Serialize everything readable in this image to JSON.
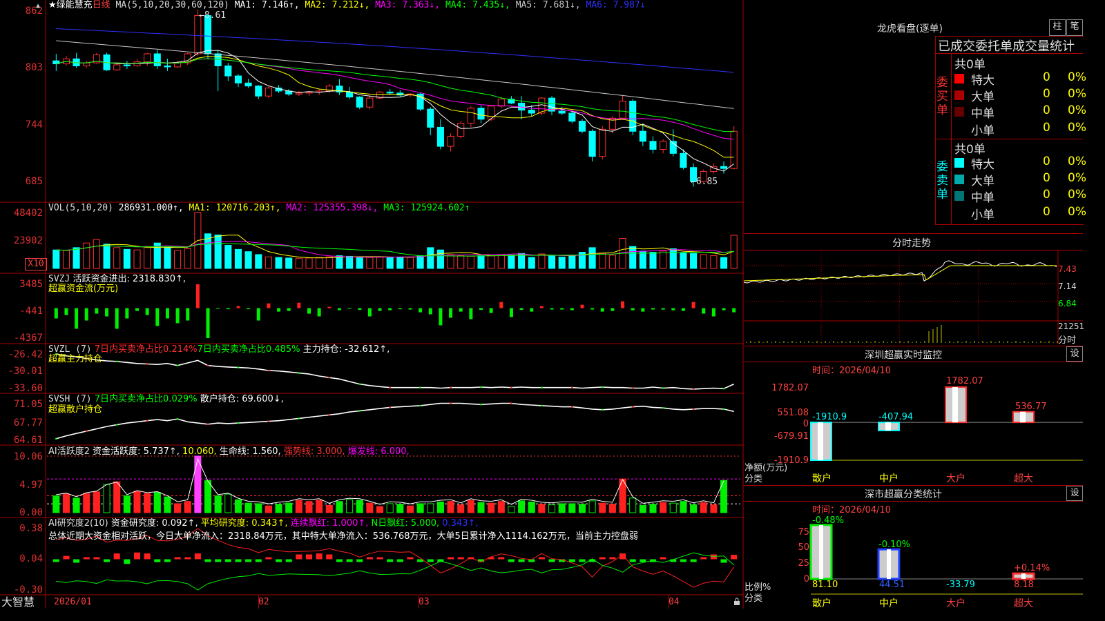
{
  "kline": {
    "title_star": "★绿能慧充",
    "period": "日线",
    "ma_header": "MA(5,10,20,30,60,120)",
    "ma": [
      {
        "label": "MA1: 7.146↑,",
        "color": "#ffffff"
      },
      {
        "label": "MA2: 7.212↓,",
        "color": "#ffff00"
      },
      {
        "label": "MA3: 7.363↓,",
        "color": "#ff00ff"
      },
      {
        "label": "MA4: 7.435↓,",
        "color": "#00ff00"
      },
      {
        "label": "MA5: 7.681↓,",
        "color": "#c8c8c8"
      },
      {
        "label": "MA6: 7.987↓",
        "color": "#3030ff"
      }
    ],
    "y_ticks": [
      "862",
      "803",
      "744",
      "685"
    ],
    "high_label": "8.61",
    "low_label": "6.85",
    "ylim": [
      6.75,
      8.65
    ]
  },
  "vol": {
    "header": "VOL(5,10,20)",
    "value": "286931.000↑,",
    "ma1": "MA1: 120716.203↑,",
    "ma2": "MA2: 125355.398↓,",
    "ma3": "MA3: 125924.602↑",
    "y_ticks": [
      "48402",
      "23902"
    ],
    "unit": "X10"
  },
  "svzj": {
    "header": "SVZJ",
    "text": "活跃资金进出: 2318.830↑,",
    "subtitle": "超赢资金流(万元)",
    "y_ticks": [
      "3485",
      "-441",
      "-4367"
    ]
  },
  "svzl": {
    "header": "SVZL (7)",
    "t1": "7日内买卖净占比0.214%",
    "t2": "7日内买卖净占比0.485%",
    "t3": "主力持仓: -32.612↑,",
    "subtitle": "超赢主力持仓",
    "y_ticks": [
      "-26.42",
      "-30.01",
      "-33.60"
    ]
  },
  "svsh": {
    "header": "SVSH (7)",
    "t1": "7日内买卖净占比0.029%",
    "t2": "散户持仓: 69.600↓,",
    "subtitle": "超赢散户持仓",
    "y_ticks": [
      "71.05",
      "67.77",
      "64.61"
    ]
  },
  "ai1": {
    "header": "AI活跃度2",
    "t1": "资金活跃度: 5.737↑,",
    "t2": "10.060,",
    "t3": "生命线: 1.560,",
    "t4": "强势线: 3.000,",
    "t5": "爆发线: 6.000,",
    "y_ticks": [
      "10.06",
      "4.97",
      "0.00"
    ]
  },
  "ai2": {
    "header": "AI研究度2(10)",
    "t1": "资金研究度: 0.092↑,",
    "t2": "平均研究度: 0.343↑,",
    "t3": "连续飘红: 1.000↑,",
    "t4": "N日飘红: 5.000,",
    "t5": "0.343↑,",
    "summary": "总体近期大资金相对活跃，今日大单净流入：2318.84万元，其中特大单净流入：536.768万元，大单5日累计净入1114.162万元，当前主力控盘弱",
    "y_ticks": [
      "0.38",
      "0.04",
      "-0.30"
    ]
  },
  "xaxis": {
    "brand": "大智慧",
    "labels": [
      "2026/01",
      "02",
      "03",
      "04"
    ]
  },
  "right": {
    "dragon_title": "龙虎看盘(逐单)",
    "btn_zhu": "柱",
    "btn_bi": "笔",
    "stats_title": "已成交委托单成交量统计",
    "buy_label": "委买单",
    "sell_label": "委卖单",
    "buy_total": "共0单",
    "sell_total": "共0单",
    "buy_rows": [
      {
        "name": "特大",
        "v1": "0",
        "v2": "0%",
        "color": "#ff0000"
      },
      {
        "name": "大单",
        "v1": "0",
        "v2": "0%",
        "color": "#aa0000"
      },
      {
        "name": "中单",
        "v1": "0",
        "v2": "0%",
        "color": "#660000"
      },
      {
        "name": "小单",
        "v1": "0",
        "v2": "0%",
        "color": "#000000"
      }
    ],
    "sell_rows": [
      {
        "name": "特大",
        "v1": "0",
        "v2": "0%",
        "color": "#00ffff"
      },
      {
        "name": "大单",
        "v1": "0",
        "v2": "0%",
        "color": "#00aaaa"
      },
      {
        "name": "中单",
        "v1": "0",
        "v2": "0%",
        "color": "#007777"
      },
      {
        "name": "小单",
        "v1": "0",
        "v2": "0%",
        "color": "#000000"
      }
    ],
    "intraday_title": "分时走势",
    "intraday_ticks": [
      "7.43",
      "7.14",
      "6.84",
      "21251",
      "分时"
    ],
    "sz_monitor_title": "深圳超赢实时监控",
    "sz_btn": "设",
    "sz_time": "时间：2026/04/10",
    "sz_ticks": [
      "1782.07",
      "551.08",
      "0",
      "-679.91",
      "-1910.9"
    ],
    "sz_unit1": "净额(万元)",
    "sz_unit2": "分类",
    "sz_cats": [
      "散户",
      "中户",
      "大户",
      "超大"
    ],
    "sz_vals": [
      "-1910.9",
      "-407.94",
      "1782.07",
      "536.77"
    ],
    "class_title": "深市超赢分类统计",
    "class_btn": "设",
    "class_time": "时间：2026/04/10",
    "class_ticks": [
      "75",
      "50",
      "25",
      "0"
    ],
    "class_unit1": "比例%",
    "class_unit2": "分类",
    "class_top": [
      "-0.48%",
      "-0.10%",
      "",
      "+0.14%"
    ],
    "class_bottom": [
      "81.10",
      "44.51",
      "-33.79",
      "8.18"
    ],
    "class_cats": [
      "散户",
      "中户",
      "大户",
      "超大"
    ]
  },
  "chart_data": [
    {
      "type": "candlestick",
      "title": "绿能慧充 日线",
      "ylim": [
        6.75,
        8.65
      ],
      "candles": [
        [
          8.1,
          8.17,
          8.0,
          8.07
        ],
        [
          8.07,
          8.15,
          8.05,
          8.12
        ],
        [
          8.12,
          8.18,
          8.03,
          8.05
        ],
        [
          8.05,
          8.1,
          8.03,
          8.08
        ],
        [
          8.08,
          8.18,
          8.07,
          8.16
        ],
        [
          8.16,
          8.18,
          8.0,
          8.01
        ],
        [
          8.01,
          8.08,
          8.0,
          8.06
        ],
        [
          8.06,
          8.1,
          8.02,
          8.05
        ],
        [
          8.05,
          8.12,
          8.04,
          8.09
        ],
        [
          8.09,
          8.18,
          8.05,
          8.17
        ],
        [
          8.17,
          8.21,
          8.02,
          8.05
        ],
        [
          8.05,
          8.12,
          8.0,
          8.04
        ],
        [
          8.04,
          8.1,
          8.03,
          8.08
        ],
        [
          8.08,
          8.18,
          8.06,
          8.17
        ],
        [
          8.17,
          8.61,
          8.15,
          8.55
        ],
        [
          8.55,
          8.56,
          8.12,
          8.17
        ],
        [
          8.17,
          8.2,
          7.8,
          8.05
        ],
        [
          8.05,
          8.08,
          7.9,
          7.95
        ],
        [
          7.95,
          7.97,
          7.84,
          7.88
        ],
        [
          7.88,
          7.92,
          7.83,
          7.85
        ],
        [
          7.85,
          7.86,
          7.72,
          7.75
        ],
        [
          7.75,
          7.85,
          7.73,
          7.83
        ],
        [
          7.83,
          7.86,
          7.78,
          7.8
        ],
        [
          7.8,
          7.82,
          7.75,
          7.77
        ],
        [
          7.77,
          7.8,
          7.75,
          7.78
        ],
        [
          7.78,
          7.8,
          7.75,
          7.79
        ],
        [
          7.79,
          7.82,
          7.76,
          7.8
        ],
        [
          7.8,
          7.87,
          7.78,
          7.85
        ],
        [
          7.85,
          7.92,
          7.76,
          7.79
        ],
        [
          7.79,
          7.84,
          7.72,
          7.74
        ],
        [
          7.74,
          7.75,
          7.62,
          7.64
        ],
        [
          7.64,
          7.76,
          7.62,
          7.73
        ],
        [
          7.73,
          7.8,
          7.72,
          7.79
        ],
        [
          7.79,
          7.82,
          7.76,
          7.78
        ],
        [
          7.78,
          7.81,
          7.74,
          7.76
        ],
        [
          7.76,
          7.78,
          7.74,
          7.77
        ],
        [
          7.77,
          7.78,
          7.6,
          7.62
        ],
        [
          7.62,
          7.64,
          7.36,
          7.44
        ],
        [
          7.44,
          7.52,
          7.22,
          7.25
        ],
        [
          7.25,
          7.38,
          7.2,
          7.35
        ],
        [
          7.35,
          7.5,
          7.33,
          7.48
        ],
        [
          7.48,
          7.65,
          7.44,
          7.63
        ],
        [
          7.63,
          7.66,
          7.48,
          7.52
        ],
        [
          7.52,
          7.66,
          7.5,
          7.65
        ],
        [
          7.65,
          7.74,
          7.63,
          7.72
        ],
        [
          7.72,
          7.75,
          7.67,
          7.68
        ],
        [
          7.68,
          7.75,
          7.52,
          7.61
        ],
        [
          7.61,
          7.66,
          7.55,
          7.58
        ],
        [
          7.58,
          7.74,
          7.56,
          7.73
        ],
        [
          7.73,
          7.75,
          7.56,
          7.6
        ],
        [
          7.6,
          7.64,
          7.56,
          7.58
        ],
        [
          7.58,
          7.61,
          7.48,
          7.5
        ],
        [
          7.5,
          7.52,
          7.38,
          7.4
        ],
        [
          7.4,
          7.42,
          7.1,
          7.15
        ],
        [
          7.15,
          7.45,
          7.12,
          7.42
        ],
        [
          7.42,
          7.55,
          7.38,
          7.53
        ],
        [
          7.53,
          7.76,
          7.52,
          7.7
        ],
        [
          7.7,
          7.72,
          7.36,
          7.4
        ],
        [
          7.4,
          7.48,
          7.25,
          7.3
        ],
        [
          7.3,
          7.35,
          7.18,
          7.22
        ],
        [
          7.22,
          7.32,
          7.18,
          7.3
        ],
        [
          7.3,
          7.42,
          7.15,
          7.18
        ],
        [
          7.18,
          7.22,
          7.02,
          7.04
        ],
        [
          7.04,
          7.08,
          6.85,
          6.9
        ],
        [
          6.9,
          7.02,
          6.88,
          7.0
        ],
        [
          7.0,
          7.08,
          6.98,
          7.05
        ],
        [
          7.05,
          7.1,
          6.98,
          7.03
        ],
        [
          7.03,
          7.45,
          7.02,
          7.4
        ]
      ]
    },
    {
      "type": "bar",
      "title": "VOL",
      "unit": "X10",
      "values": [
        16000,
        15500,
        18000,
        22000,
        25000,
        21000,
        18000,
        16500,
        16000,
        19000,
        22000,
        18000,
        15500,
        17000,
        48400,
        30000,
        29000,
        20000,
        16500,
        14500,
        12000,
        10000,
        9500,
        9000,
        8800,
        9000,
        9500,
        10000,
        11000,
        10500,
        9800,
        9500,
        10000,
        9700,
        9900,
        9600,
        11000,
        18000,
        16000,
        12000,
        11000,
        10500,
        11000,
        10800,
        12000,
        11500,
        13000,
        9500,
        12500,
        11000,
        9800,
        11500,
        14000,
        18000,
        13000,
        11500,
        26000,
        19000,
        15000,
        14000,
        15000,
        17000,
        13500,
        13000,
        12000,
        11000,
        9500,
        28693
      ]
    },
    {
      "type": "bar",
      "title": "SVZJ 活跃资金进出",
      "values": [
        -1500,
        -1000,
        -3000,
        -1800,
        -800,
        -1200,
        -3000,
        -1500,
        -400,
        -1000,
        -2600,
        -1500,
        -2200,
        -1800,
        3485,
        -4367,
        -100,
        -150,
        300,
        -150,
        -1800,
        700,
        -500,
        -400,
        800,
        -800,
        -1200,
        200,
        -300,
        -100,
        -250,
        -1200,
        -400,
        -300,
        -150,
        -200,
        -600,
        -900,
        -2500,
        -1400,
        -500,
        -1600,
        -250,
        -700,
        900,
        -1300,
        -250,
        -500,
        300,
        -200,
        -200,
        -300,
        500,
        -200,
        -500,
        -400,
        1000,
        -300,
        -500,
        -200,
        -200,
        -300,
        -400,
        900,
        -800,
        -1200,
        -300,
        -600,
        2318
      ]
    },
    {
      "type": "line",
      "title": "SVZL 主力持仓",
      "values": [
        -26.6,
        -27.0,
        -27.2,
        -27.5,
        -27.8,
        -28.0,
        -28.1,
        -28.3,
        -28.5,
        -28.6,
        -28.7,
        -28.5,
        -28.9,
        -28.4,
        -27.9,
        -28.9,
        -29.1,
        -29.2,
        -29.3,
        -29.4,
        -29.6,
        -29.9,
        -30.0,
        -30.2,
        -30.4,
        -30.6,
        -31.0,
        -31.3,
        -31.6,
        -32.1,
        -32.6,
        -32.9,
        -33.1,
        -33.3,
        -33.3,
        -33.3,
        -33.3,
        -33.3,
        -33.4,
        -33.3,
        -33.3,
        -33.3,
        -33.2,
        -33.3,
        -33.2,
        -33.3,
        -33.2,
        -33.3,
        -33.3,
        -33.3,
        -33.3,
        -33.3,
        -33.4,
        -33.3,
        -33.2,
        -33.3,
        -33.3,
        -33.4,
        -33.4,
        -33.2,
        -33.4,
        -33.3,
        -33.5,
        -33.6,
        -33.5,
        -33.4,
        -33.5,
        -32.6
      ]
    },
    {
      "type": "line",
      "title": "SVSH 散户持仓",
      "values": [
        64.9,
        65.4,
        65.8,
        66.2,
        66.6,
        67.0,
        67.3,
        67.6,
        67.8,
        68.0,
        68.2,
        68.0,
        68.3,
        67.8,
        67.6,
        67.4,
        67.6,
        67.5,
        67.6,
        67.7,
        67.8,
        67.9,
        68.0,
        68.2,
        68.4,
        68.6,
        68.8,
        69.0,
        69.2,
        69.5,
        69.7,
        69.9,
        70.1,
        70.3,
        70.4,
        70.5,
        70.6,
        70.8,
        71.0,
        71.0,
        71.0,
        70.9,
        70.8,
        70.9,
        71.0,
        71.0,
        70.8,
        70.7,
        70.6,
        70.5,
        70.4,
        70.4,
        70.2,
        70.0,
        69.9,
        70.0,
        70.2,
        70.4,
        70.5,
        70.3,
        70.2,
        70.0,
        69.9,
        70.0,
        70.1,
        70.1,
        70.0,
        69.6
      ]
    },
    {
      "type": "bar",
      "title": "AI活跃度2",
      "values": [
        3.0,
        3.3,
        2.6,
        3.4,
        3.7,
        5.0,
        5.5,
        3.0,
        3.8,
        3.4,
        3.6,
        2.8,
        1.6,
        2.0,
        10.06,
        5.7,
        3.0,
        3.3,
        2.3,
        1.7,
        1.6,
        1.2,
        1.5,
        1.7,
        2.2,
        2.0,
        2.2,
        1.3,
        2.0,
        2.3,
        2.2,
        1.7,
        1.1,
        1.6,
        1.5,
        1.2,
        1.6,
        1.6,
        1.9,
        2.0,
        1.4,
        2.2,
        1.8,
        1.7,
        2.0,
        1.1,
        2.1,
        1.9,
        1.5,
        1.4,
        1.6,
        1.6,
        1.5,
        2.1,
        1.7,
        1.5,
        6.0,
        2.6,
        1.3,
        1.5,
        1.8,
        1.7,
        2.0,
        1.4,
        1.8,
        1.4,
        5.737
      ]
    },
    {
      "type": "bar",
      "title": "AI研究度2",
      "values": [
        0.04,
        0.07,
        0.12,
        0.04,
        0.01,
        0.06,
        0.12,
        0.16,
        0.14,
        0.12,
        0.1,
        0.06,
        0.04,
        0.02,
        0.12,
        0.02,
        0.01,
        0.01,
        0.02,
        0.01,
        0.02,
        0.04,
        0.06,
        0.08,
        0.1,
        0.1,
        0.12,
        0.1,
        0.05,
        0.01,
        0.01,
        0.01,
        0.01,
        0.01,
        0.02,
        0.01,
        0.01,
        0.01,
        0.01,
        0.01,
        0.01,
        0.01,
        0.01,
        0.01,
        0.02,
        0.01,
        0.02,
        0.01,
        0.01,
        0.01,
        0.01,
        0.01,
        0.01,
        0.02,
        0.01,
        0.02,
        0.12,
        0.08,
        0.01,
        0.01,
        0.02,
        0.01,
        0.01,
        0.02,
        0.02,
        0.1,
        0.12,
        0.092
      ]
    },
    {
      "type": "line",
      "title": "分时走势",
      "ylim": [
        6.84,
        7.43
      ]
    },
    {
      "type": "bar",
      "title": "深圳超赢实时监控",
      "categories": [
        "散户",
        "中户",
        "大户",
        "超大"
      ],
      "values": [
        -1910.9,
        -407.94,
        1782.07,
        536.77
      ],
      "ylim": [
        -1910.9,
        1782.07
      ]
    },
    {
      "type": "bar",
      "title": "深市超赢分类统计",
      "categories": [
        "散户",
        "中户",
        "大户",
        "超大"
      ],
      "values": [
        81.1,
        44.51,
        -33.79,
        8.18
      ],
      "ylim": [
        0,
        80
      ]
    }
  ]
}
